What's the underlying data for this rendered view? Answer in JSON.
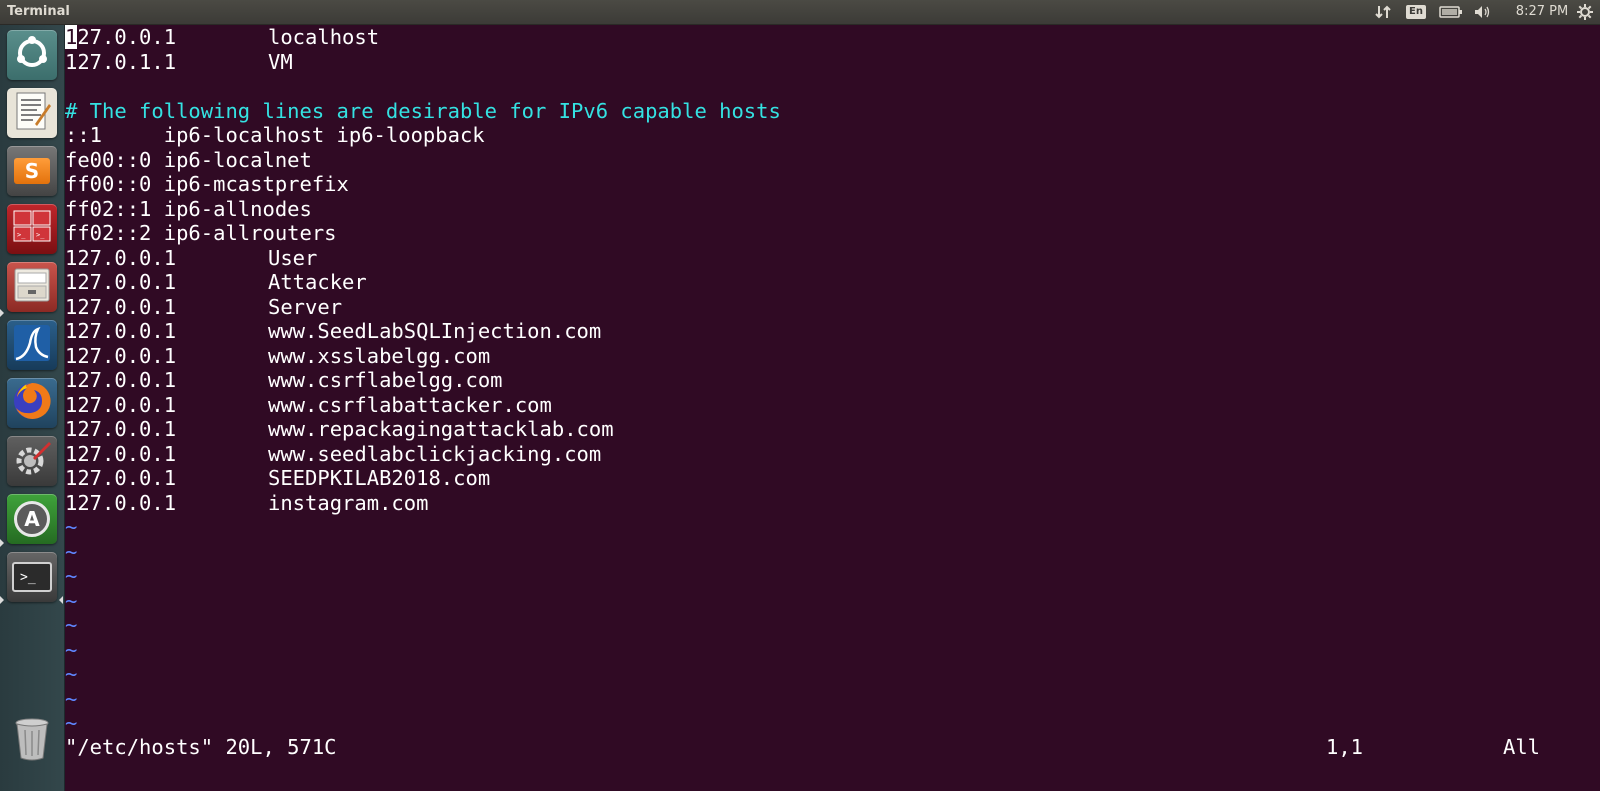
{
  "panel": {
    "app_title": "Terminal",
    "language": "En",
    "clock": "8:27 PM"
  },
  "launcher": {
    "items": [
      {
        "name": "ubuntu-dash",
        "icon": "ubuntu-logo-icon"
      },
      {
        "name": "text-editor",
        "icon": "text-editor-icon"
      },
      {
        "name": "sublime-text",
        "icon": "sublime-text-icon",
        "glyph": "S"
      },
      {
        "name": "terminator",
        "icon": "terminator-icon"
      },
      {
        "name": "file-cabinet",
        "icon": "file-cabinet-icon"
      },
      {
        "name": "wireshark",
        "icon": "wireshark-icon"
      },
      {
        "name": "firefox",
        "icon": "firefox-icon"
      },
      {
        "name": "system-settings",
        "icon": "system-settings-icon"
      },
      {
        "name": "software-updater",
        "icon": "software-updater-icon",
        "glyph": "A"
      },
      {
        "name": "terminal",
        "icon": "terminal-icon",
        "glyph": ">_"
      },
      {
        "name": "trash",
        "icon": "trash-icon"
      }
    ]
  },
  "editor": {
    "lines": [
      {
        "addr": "127.0.0.1",
        "host": "localhost"
      },
      {
        "addr": "127.0.1.1",
        "host": "VM"
      },
      {
        "text": ""
      },
      {
        "comment": "# The following lines are desirable for IPv6 capable hosts"
      },
      {
        "text": "::1     ip6-localhost ip6-loopback"
      },
      {
        "text": "fe00::0 ip6-localnet"
      },
      {
        "text": "ff00::0 ip6-mcastprefix"
      },
      {
        "text": "ff02::1 ip6-allnodes"
      },
      {
        "text": "ff02::2 ip6-allrouters"
      },
      {
        "addr": "127.0.0.1",
        "host": "User"
      },
      {
        "addr": "127.0.0.1",
        "host": "Attacker"
      },
      {
        "addr": "127.0.0.1",
        "host": "Server"
      },
      {
        "addr": "127.0.0.1",
        "host": "www.SeedLabSQLInjection.com"
      },
      {
        "addr": "127.0.0.1",
        "host": "www.xsslabelgg.com"
      },
      {
        "addr": "127.0.0.1",
        "host": "www.csrflabelgg.com"
      },
      {
        "addr": "127.0.0.1",
        "host": "www.csrflabattacker.com"
      },
      {
        "addr": "127.0.0.1",
        "host": "www.repackagingattacklab.com"
      },
      {
        "addr": "127.0.0.1",
        "host": "www.seedlabclickjacking.com"
      },
      {
        "addr": "127.0.0.1",
        "host": "SEEDPKILAB2018.com"
      },
      {
        "addr": "127.0.0.1",
        "host": "instagram.com"
      }
    ],
    "first_char": "1",
    "first_rest": "27.0.0.1",
    "tilde": "~",
    "status": {
      "file": "\"/etc/hosts\" 20L, 571C",
      "position": "1,1",
      "scroll": "All"
    }
  },
  "colors": {
    "background": "#300a24",
    "text": "#ffffff",
    "comment": "#34e2e2",
    "tilde": "#5f87ff"
  }
}
